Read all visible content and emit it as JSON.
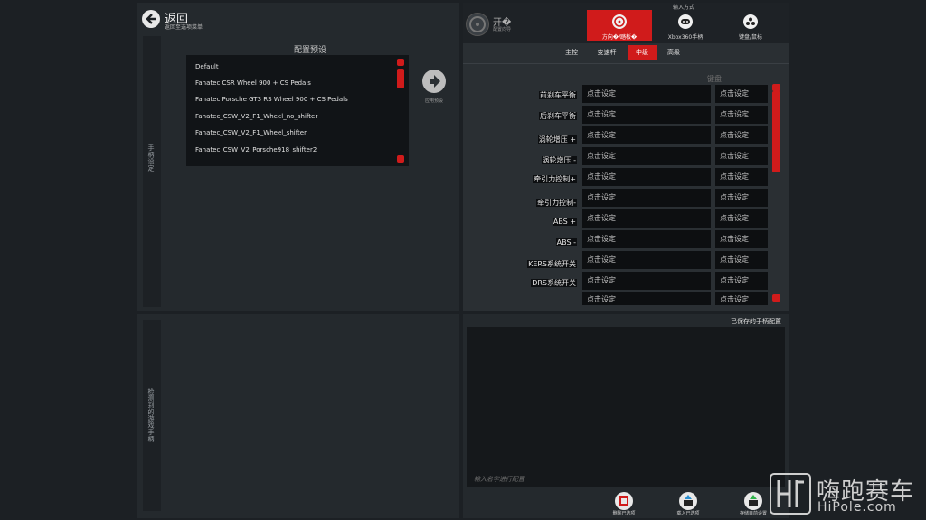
{
  "header": {
    "back_title": "返回",
    "back_subtitle": "返回至选项菜单"
  },
  "left_panel": {
    "vertical_label": "手柄设定",
    "presets_title": "配置预设",
    "presets": [
      "Default",
      "Fanatec CSR Wheel 900 + CS Pedals",
      "Fanatec Porsche GT3 RS Wheel 900 + CS Pedals",
      "Fanatec_CSW_V2_F1_Wheel_no_shifter",
      "Fanatec_CSW_V2_F1_Wheel_shifter",
      "Fanatec_CSW_V2_Porsche918_shifter2"
    ],
    "apply_label": "应用预设"
  },
  "bottom_left": {
    "vertical_label": "检测到的游戏手柄"
  },
  "right_panel": {
    "toggle_title": "开�",
    "toggle_sub": "配置向导",
    "input_mode_label": "输入方式",
    "modes": [
      {
        "label": "方向�/踏板�",
        "icon": "steering-wheel-icon",
        "active": true
      },
      {
        "label": "Xbox360手柄",
        "icon": "gamepad-icon",
        "active": false
      },
      {
        "label": "键盘/鼠标",
        "icon": "keyboard-icon",
        "active": false
      }
    ],
    "tabs": [
      {
        "label": "主控",
        "active": false
      },
      {
        "label": "变速杆",
        "active": false
      },
      {
        "label": "中级",
        "active": true
      },
      {
        "label": "高级",
        "active": false
      }
    ],
    "column_header": "键盘",
    "rows": [
      {
        "label": "前刹车平衡",
        "primary": "点击设定",
        "secondary": "点击设定"
      },
      {
        "label": "后刹车平衡",
        "primary": "点击设定",
        "secondary": "点击设定"
      },
      {
        "label": "涡轮增压 +",
        "primary": "点击设定",
        "secondary": "点击设定"
      },
      {
        "label": "涡轮增压 -",
        "primary": "点击设定",
        "secondary": "点击设定"
      },
      {
        "label": "牵引力控制+",
        "primary": "点击设定",
        "secondary": "点击设定"
      },
      {
        "label": "牵引力控制-",
        "primary": "点击设定",
        "secondary": "点击设定"
      },
      {
        "label": "ABS +",
        "primary": "点击设定",
        "secondary": "点击设定"
      },
      {
        "label": "ABS -",
        "primary": "点击设定",
        "secondary": "点击设定"
      },
      {
        "label": "KERS系统开关",
        "primary": "点击设定",
        "secondary": "点击设定"
      },
      {
        "label": "DRS系统开关",
        "primary": "点击设定",
        "secondary": "点击设定"
      },
      {
        "label": "",
        "primary": "点击设定",
        "secondary": "点击设定"
      }
    ]
  },
  "saved": {
    "title": "已保存的手柄配置",
    "name_placeholder": "输入名字进行配置",
    "buttons": [
      {
        "label": "删除已选项",
        "icon": "delete-icon",
        "color": "#d01b1b"
      },
      {
        "label": "载入已选项",
        "icon": "load-icon",
        "color": "#2a8fd0"
      },
      {
        "label": "存储目前设置",
        "icon": "save-icon",
        "color": "#2fb34a"
      }
    ]
  },
  "watermark": {
    "cn": "嗨跑赛车",
    "en": "HiPole.com"
  },
  "colors": {
    "accent": "#d01b1b",
    "background": "#1c2024",
    "panel": "#24292d"
  }
}
